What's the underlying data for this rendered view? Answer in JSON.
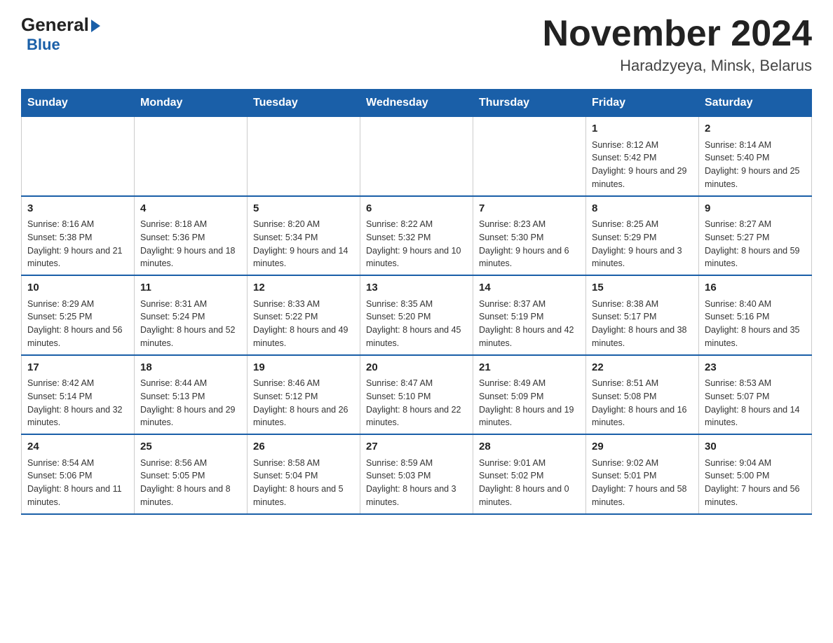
{
  "logo": {
    "text_general": "General",
    "text_blue": "Blue"
  },
  "title": "November 2024",
  "subtitle": "Haradzyeya, Minsk, Belarus",
  "days_of_week": [
    "Sunday",
    "Monday",
    "Tuesday",
    "Wednesday",
    "Thursday",
    "Friday",
    "Saturday"
  ],
  "weeks": [
    [
      {
        "day": "",
        "sunrise": "",
        "sunset": "",
        "daylight": ""
      },
      {
        "day": "",
        "sunrise": "",
        "sunset": "",
        "daylight": ""
      },
      {
        "day": "",
        "sunrise": "",
        "sunset": "",
        "daylight": ""
      },
      {
        "day": "",
        "sunrise": "",
        "sunset": "",
        "daylight": ""
      },
      {
        "day": "",
        "sunrise": "",
        "sunset": "",
        "daylight": ""
      },
      {
        "day": "1",
        "sunrise": "Sunrise: 8:12 AM",
        "sunset": "Sunset: 5:42 PM",
        "daylight": "Daylight: 9 hours and 29 minutes."
      },
      {
        "day": "2",
        "sunrise": "Sunrise: 8:14 AM",
        "sunset": "Sunset: 5:40 PM",
        "daylight": "Daylight: 9 hours and 25 minutes."
      }
    ],
    [
      {
        "day": "3",
        "sunrise": "Sunrise: 8:16 AM",
        "sunset": "Sunset: 5:38 PM",
        "daylight": "Daylight: 9 hours and 21 minutes."
      },
      {
        "day": "4",
        "sunrise": "Sunrise: 8:18 AM",
        "sunset": "Sunset: 5:36 PM",
        "daylight": "Daylight: 9 hours and 18 minutes."
      },
      {
        "day": "5",
        "sunrise": "Sunrise: 8:20 AM",
        "sunset": "Sunset: 5:34 PM",
        "daylight": "Daylight: 9 hours and 14 minutes."
      },
      {
        "day": "6",
        "sunrise": "Sunrise: 8:22 AM",
        "sunset": "Sunset: 5:32 PM",
        "daylight": "Daylight: 9 hours and 10 minutes."
      },
      {
        "day": "7",
        "sunrise": "Sunrise: 8:23 AM",
        "sunset": "Sunset: 5:30 PM",
        "daylight": "Daylight: 9 hours and 6 minutes."
      },
      {
        "day": "8",
        "sunrise": "Sunrise: 8:25 AM",
        "sunset": "Sunset: 5:29 PM",
        "daylight": "Daylight: 9 hours and 3 minutes."
      },
      {
        "day": "9",
        "sunrise": "Sunrise: 8:27 AM",
        "sunset": "Sunset: 5:27 PM",
        "daylight": "Daylight: 8 hours and 59 minutes."
      }
    ],
    [
      {
        "day": "10",
        "sunrise": "Sunrise: 8:29 AM",
        "sunset": "Sunset: 5:25 PM",
        "daylight": "Daylight: 8 hours and 56 minutes."
      },
      {
        "day": "11",
        "sunrise": "Sunrise: 8:31 AM",
        "sunset": "Sunset: 5:24 PM",
        "daylight": "Daylight: 8 hours and 52 minutes."
      },
      {
        "day": "12",
        "sunrise": "Sunrise: 8:33 AM",
        "sunset": "Sunset: 5:22 PM",
        "daylight": "Daylight: 8 hours and 49 minutes."
      },
      {
        "day": "13",
        "sunrise": "Sunrise: 8:35 AM",
        "sunset": "Sunset: 5:20 PM",
        "daylight": "Daylight: 8 hours and 45 minutes."
      },
      {
        "day": "14",
        "sunrise": "Sunrise: 8:37 AM",
        "sunset": "Sunset: 5:19 PM",
        "daylight": "Daylight: 8 hours and 42 minutes."
      },
      {
        "day": "15",
        "sunrise": "Sunrise: 8:38 AM",
        "sunset": "Sunset: 5:17 PM",
        "daylight": "Daylight: 8 hours and 38 minutes."
      },
      {
        "day": "16",
        "sunrise": "Sunrise: 8:40 AM",
        "sunset": "Sunset: 5:16 PM",
        "daylight": "Daylight: 8 hours and 35 minutes."
      }
    ],
    [
      {
        "day": "17",
        "sunrise": "Sunrise: 8:42 AM",
        "sunset": "Sunset: 5:14 PM",
        "daylight": "Daylight: 8 hours and 32 minutes."
      },
      {
        "day": "18",
        "sunrise": "Sunrise: 8:44 AM",
        "sunset": "Sunset: 5:13 PM",
        "daylight": "Daylight: 8 hours and 29 minutes."
      },
      {
        "day": "19",
        "sunrise": "Sunrise: 8:46 AM",
        "sunset": "Sunset: 5:12 PM",
        "daylight": "Daylight: 8 hours and 26 minutes."
      },
      {
        "day": "20",
        "sunrise": "Sunrise: 8:47 AM",
        "sunset": "Sunset: 5:10 PM",
        "daylight": "Daylight: 8 hours and 22 minutes."
      },
      {
        "day": "21",
        "sunrise": "Sunrise: 8:49 AM",
        "sunset": "Sunset: 5:09 PM",
        "daylight": "Daylight: 8 hours and 19 minutes."
      },
      {
        "day": "22",
        "sunrise": "Sunrise: 8:51 AM",
        "sunset": "Sunset: 5:08 PM",
        "daylight": "Daylight: 8 hours and 16 minutes."
      },
      {
        "day": "23",
        "sunrise": "Sunrise: 8:53 AM",
        "sunset": "Sunset: 5:07 PM",
        "daylight": "Daylight: 8 hours and 14 minutes."
      }
    ],
    [
      {
        "day": "24",
        "sunrise": "Sunrise: 8:54 AM",
        "sunset": "Sunset: 5:06 PM",
        "daylight": "Daylight: 8 hours and 11 minutes."
      },
      {
        "day": "25",
        "sunrise": "Sunrise: 8:56 AM",
        "sunset": "Sunset: 5:05 PM",
        "daylight": "Daylight: 8 hours and 8 minutes."
      },
      {
        "day": "26",
        "sunrise": "Sunrise: 8:58 AM",
        "sunset": "Sunset: 5:04 PM",
        "daylight": "Daylight: 8 hours and 5 minutes."
      },
      {
        "day": "27",
        "sunrise": "Sunrise: 8:59 AM",
        "sunset": "Sunset: 5:03 PM",
        "daylight": "Daylight: 8 hours and 3 minutes."
      },
      {
        "day": "28",
        "sunrise": "Sunrise: 9:01 AM",
        "sunset": "Sunset: 5:02 PM",
        "daylight": "Daylight: 8 hours and 0 minutes."
      },
      {
        "day": "29",
        "sunrise": "Sunrise: 9:02 AM",
        "sunset": "Sunset: 5:01 PM",
        "daylight": "Daylight: 7 hours and 58 minutes."
      },
      {
        "day": "30",
        "sunrise": "Sunrise: 9:04 AM",
        "sunset": "Sunset: 5:00 PM",
        "daylight": "Daylight: 7 hours and 56 minutes."
      }
    ]
  ]
}
